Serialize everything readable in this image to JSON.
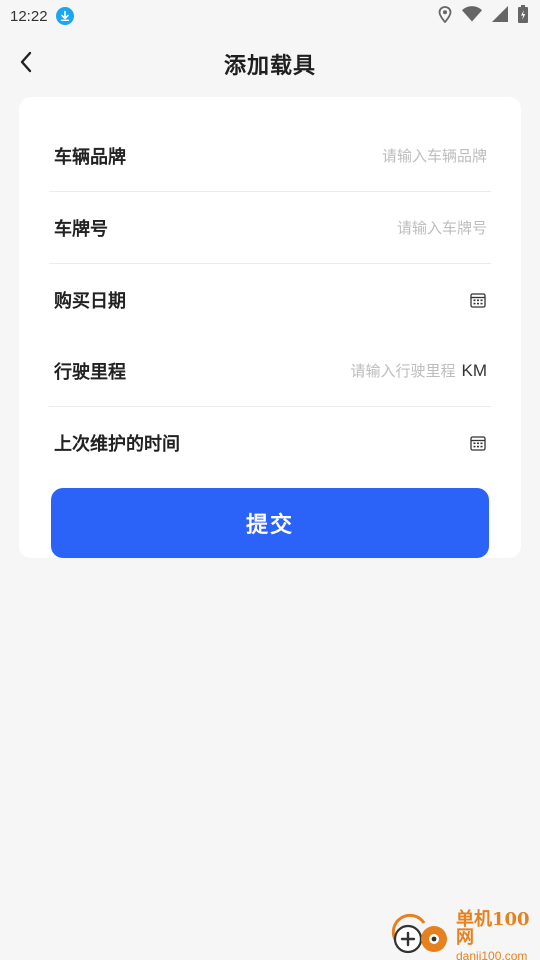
{
  "status_bar": {
    "time": "12:22",
    "icons": [
      "download-icon",
      "location-icon",
      "wifi-icon",
      "signal-icon",
      "battery-icon"
    ]
  },
  "header": {
    "title": "添加载具",
    "back_icon": "chevron-left-icon"
  },
  "form": {
    "brand": {
      "label": "车辆品牌",
      "placeholder": "请输入车辆品牌",
      "value": ""
    },
    "plate": {
      "label": "车牌号",
      "placeholder": "请输入车牌号",
      "value": ""
    },
    "purchase_date": {
      "label": "购买日期",
      "icon": "calendar-icon"
    },
    "mileage": {
      "label": "行驶里程",
      "placeholder": "请输入行驶里程",
      "unit": "KM",
      "value": ""
    },
    "last_maintenance": {
      "label": "上次维护的时间",
      "icon": "calendar-icon"
    },
    "submit_label": "提交"
  },
  "colors": {
    "primary": "#2b62f8",
    "background": "#f6f6f6",
    "card": "#ffffff",
    "placeholder": "#bdbdbd",
    "watermark": "#e5821f"
  },
  "watermark": {
    "title": "单机100网",
    "url": "danji100.com"
  }
}
